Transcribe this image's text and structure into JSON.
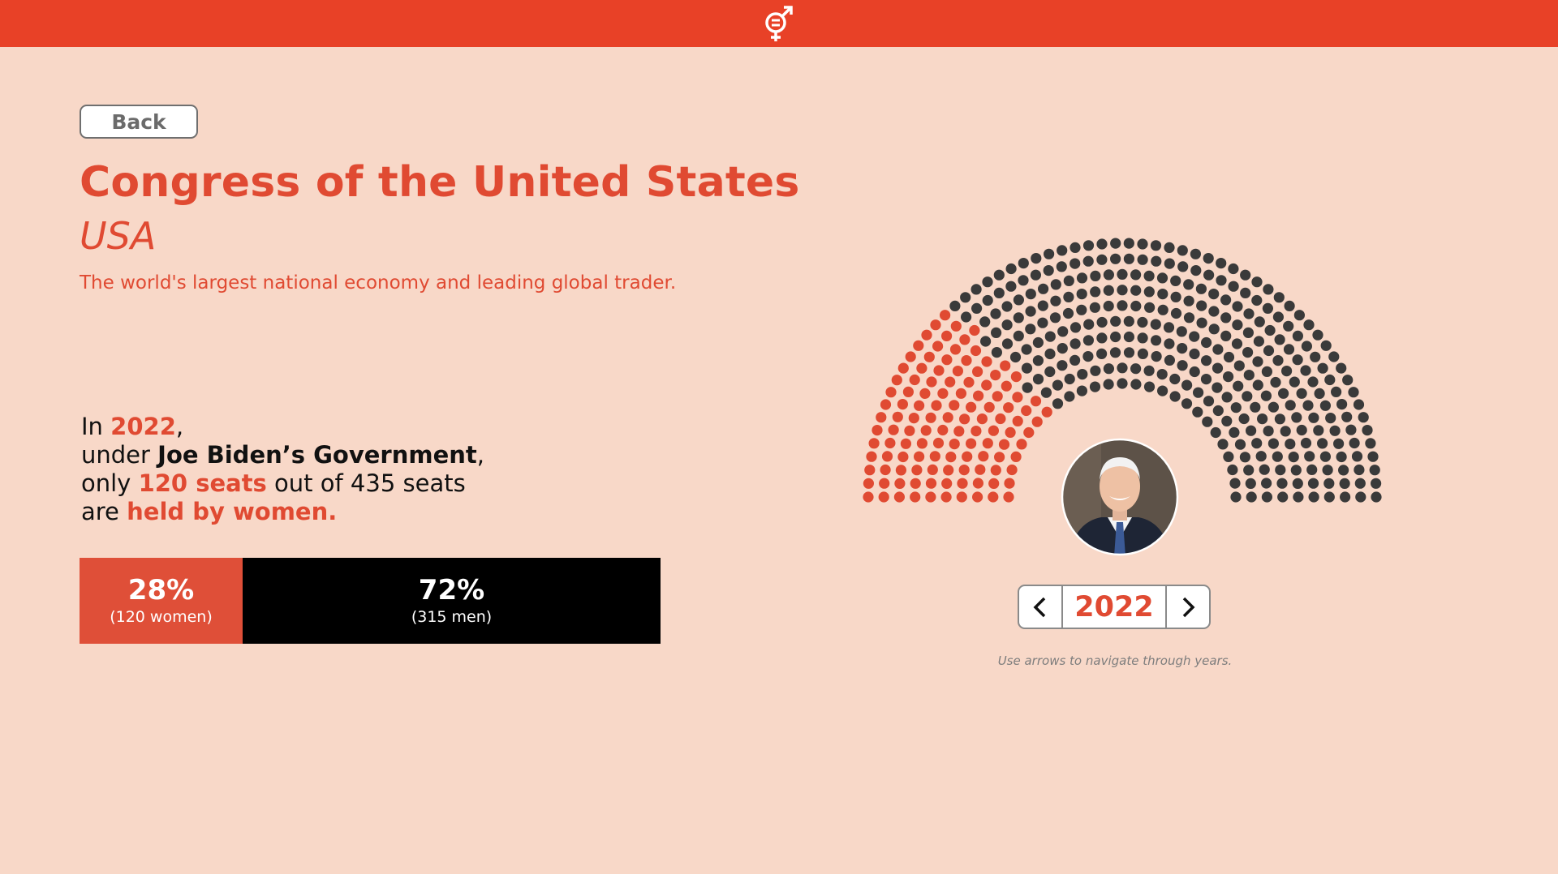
{
  "header": {
    "logo_icon": "gender-equality-icon"
  },
  "nav": {
    "back_label": "Back"
  },
  "title": "Congress of the United States",
  "country": "USA",
  "tagline": "The world's largest national economy and leading global trader.",
  "statement": {
    "line1_prefix": "In ",
    "year": "2022",
    "line1_suffix": ",",
    "line2_prefix": "under ",
    "government": "Joe Biden’s Government",
    "line2_suffix": ",",
    "line3_prefix": "only ",
    "seats_women": "120 seats",
    "line3_suffix": " out of 435 seats",
    "line4_prefix": "are ",
    "held": "held by women."
  },
  "bar": {
    "women_pct": "28%",
    "women_count": "(120 women)",
    "men_pct": "72%",
    "men_count": "(315 men)"
  },
  "chart_data": {
    "type": "hemicycle",
    "total_seats": 435,
    "series": [
      {
        "name": "women",
        "value": 120,
        "color": "#e04a32"
      },
      {
        "name": "men",
        "value": 315,
        "color": "#3a3a3a"
      }
    ]
  },
  "year_nav": {
    "year": "2022",
    "prev_icon": "chevron-left-icon",
    "next_icon": "chevron-right-icon"
  },
  "hint": "Use arrows to navigate through years.",
  "colors": {
    "accent": "#e84127",
    "background": "#f8d8c8",
    "women": "#e04a32",
    "men": "#3a3a3a"
  }
}
